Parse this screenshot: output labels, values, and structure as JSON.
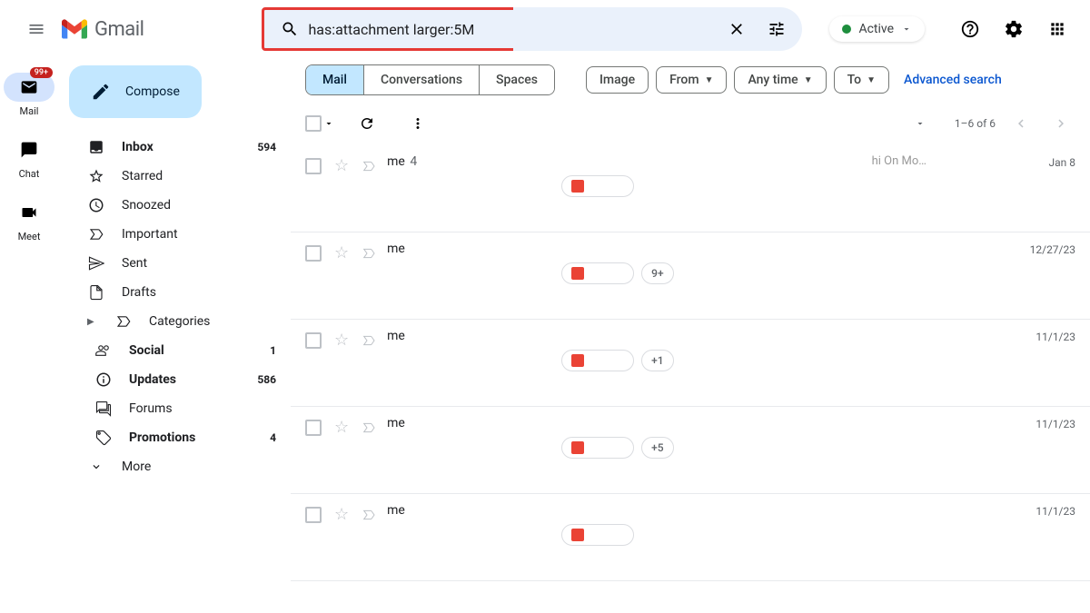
{
  "header": {
    "product_name": "Gmail",
    "search_value": "has:attachment larger:5M",
    "status_label": "Active"
  },
  "rail": {
    "badge": "99+",
    "items": [
      {
        "label": "Mail"
      },
      {
        "label": "Chat"
      },
      {
        "label": "Meet"
      }
    ]
  },
  "sidebar": {
    "compose_label": "Compose",
    "folders": [
      {
        "name": "Inbox",
        "count": "594",
        "bold": true
      },
      {
        "name": "Starred",
        "count": ""
      },
      {
        "name": "Snoozed",
        "count": ""
      },
      {
        "name": "Important",
        "count": ""
      },
      {
        "name": "Sent",
        "count": ""
      },
      {
        "name": "Drafts",
        "count": ""
      },
      {
        "name": "Categories",
        "count": ""
      },
      {
        "name": "Social",
        "count": "1",
        "indent": true,
        "bold": true
      },
      {
        "name": "Updates",
        "count": "586",
        "indent": true,
        "bold": true
      },
      {
        "name": "Forums",
        "count": "",
        "indent": true
      },
      {
        "name": "Promotions",
        "count": "4",
        "indent": true,
        "bold": true
      },
      {
        "name": "More",
        "count": ""
      }
    ]
  },
  "toolbar": {
    "scopes": [
      "Mail",
      "Conversations",
      "Spaces"
    ],
    "chips": {
      "image": "Image",
      "from": "From",
      "any_time": "Any time",
      "to": "To"
    },
    "advanced": "Advanced search"
  },
  "list_toolbar": {
    "pagination": "1–6 of 6"
  },
  "emails": [
    {
      "sender": "me",
      "sender_count": "4",
      "snippet": "hi On Mo…",
      "date": "Jan 8",
      "attach_extra": ""
    },
    {
      "sender": "me",
      "sender_count": "",
      "snippet": "",
      "date": "12/27/23",
      "attach_extra": "9+"
    },
    {
      "sender": "me",
      "sender_count": "",
      "snippet": "",
      "date": "11/1/23",
      "attach_extra": "+1"
    },
    {
      "sender": "me",
      "sender_count": "",
      "snippet": "",
      "date": "11/1/23",
      "attach_extra": "+5"
    },
    {
      "sender": "me",
      "sender_count": "",
      "snippet": "",
      "date": "11/1/23",
      "attach_extra": ""
    }
  ]
}
